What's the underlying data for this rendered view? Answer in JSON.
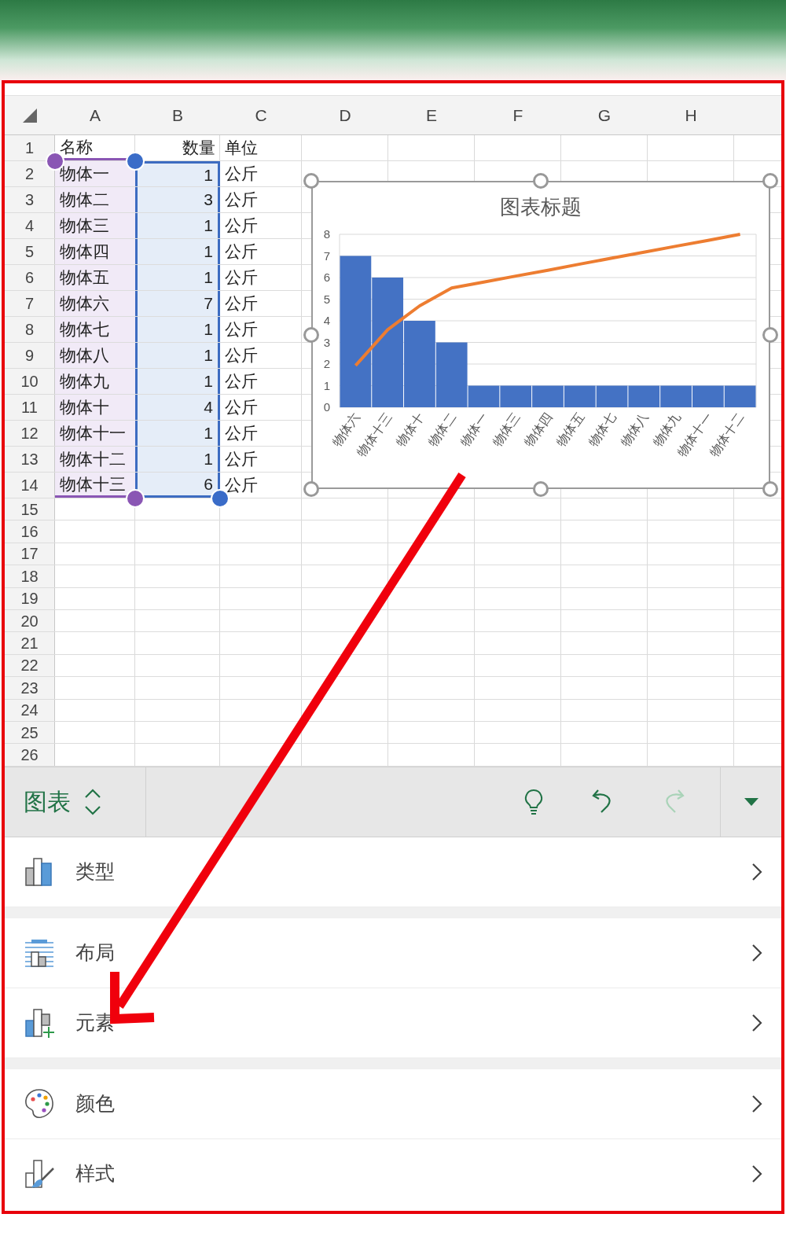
{
  "sheet": {
    "columns": [
      "A",
      "B",
      "C",
      "D",
      "E",
      "F",
      "G",
      "H"
    ],
    "rows": [
      {
        "number": "1",
        "selected": false,
        "cells": [
          "名称",
          "数量",
          "单位"
        ]
      },
      {
        "number": "2",
        "selected": true,
        "cells": [
          "物体一",
          "1",
          "公斤"
        ]
      },
      {
        "number": "3",
        "selected": true,
        "cells": [
          "物体二",
          "3",
          "公斤"
        ]
      },
      {
        "number": "4",
        "selected": true,
        "cells": [
          "物体三",
          "1",
          "公斤"
        ]
      },
      {
        "number": "5",
        "selected": true,
        "cells": [
          "物体四",
          "1",
          "公斤"
        ]
      },
      {
        "number": "6",
        "selected": true,
        "cells": [
          "物体五",
          "1",
          "公斤"
        ]
      },
      {
        "number": "7",
        "selected": true,
        "cells": [
          "物体六",
          "7",
          "公斤"
        ]
      },
      {
        "number": "8",
        "selected": true,
        "cells": [
          "物体七",
          "1",
          "公斤"
        ]
      },
      {
        "number": "9",
        "selected": true,
        "cells": [
          "物体八",
          "1",
          "公斤"
        ]
      },
      {
        "number": "10",
        "selected": true,
        "cells": [
          "物体九",
          "1",
          "公斤"
        ]
      },
      {
        "number": "11",
        "selected": true,
        "cells": [
          "物体十",
          "4",
          "公斤"
        ]
      },
      {
        "number": "12",
        "selected": true,
        "cells": [
          "物体十一",
          "1",
          "公斤"
        ]
      },
      {
        "number": "13",
        "selected": true,
        "cells": [
          "物体十二",
          "1",
          "公斤"
        ]
      },
      {
        "number": "14",
        "selected": true,
        "cells": [
          "物体十三",
          "6",
          "公斤"
        ]
      },
      {
        "number": "15",
        "selected": false,
        "cells": []
      },
      {
        "number": "16",
        "selected": false,
        "cells": []
      },
      {
        "number": "17",
        "selected": false,
        "cells": []
      },
      {
        "number": "18",
        "selected": false,
        "cells": []
      },
      {
        "number": "19",
        "selected": false,
        "cells": []
      },
      {
        "number": "20",
        "selected": false,
        "cells": []
      },
      {
        "number": "21",
        "selected": false,
        "cells": []
      },
      {
        "number": "22",
        "selected": false,
        "cells": []
      },
      {
        "number": "23",
        "selected": false,
        "cells": []
      },
      {
        "number": "24",
        "selected": false,
        "cells": []
      },
      {
        "number": "25",
        "selected": false,
        "cells": []
      },
      {
        "number": "26",
        "selected": false,
        "cells": []
      }
    ]
  },
  "chart": {
    "chart_data": {
      "type": "bar",
      "title": "图表标题",
      "categories": [
        "物体六",
        "物体十三",
        "物体十",
        "物体二",
        "物体一",
        "物体三",
        "物体四",
        "物体五",
        "物体七",
        "物体八",
        "物体九",
        "物体十一",
        "物体十二"
      ],
      "series": [
        {
          "type": "bar",
          "color": "#4472c4",
          "values": [
            7,
            6,
            4,
            3,
            1,
            1,
            1,
            1,
            1,
            1,
            1,
            1,
            1
          ]
        },
        {
          "type": "line",
          "color": "#ed7d31",
          "values": [
            1.93,
            3.59,
            4.69,
            5.52,
            5.79,
            6.07,
            6.34,
            6.62,
            6.9,
            7.17,
            7.45,
            7.72,
            8
          ]
        }
      ],
      "ylim": [
        0,
        8
      ],
      "yticks": [
        0,
        1,
        2,
        3,
        4,
        5,
        6,
        7,
        8
      ],
      "grid": true
    }
  },
  "toolbar": {
    "title": "图表",
    "buttons": [
      {
        "kind": "ideas",
        "disabled": false
      },
      {
        "kind": "undo",
        "disabled": false
      },
      {
        "kind": "redo",
        "disabled": true
      }
    ]
  },
  "menu_groups": [
    [
      {
        "kind": "type",
        "label": "类型"
      }
    ],
    [
      {
        "kind": "layout",
        "label": "布局"
      },
      {
        "kind": "elements",
        "label": "元素"
      }
    ],
    [
      {
        "kind": "colors",
        "label": "颜色"
      },
      {
        "kind": "styles",
        "label": "样式"
      }
    ]
  ]
}
